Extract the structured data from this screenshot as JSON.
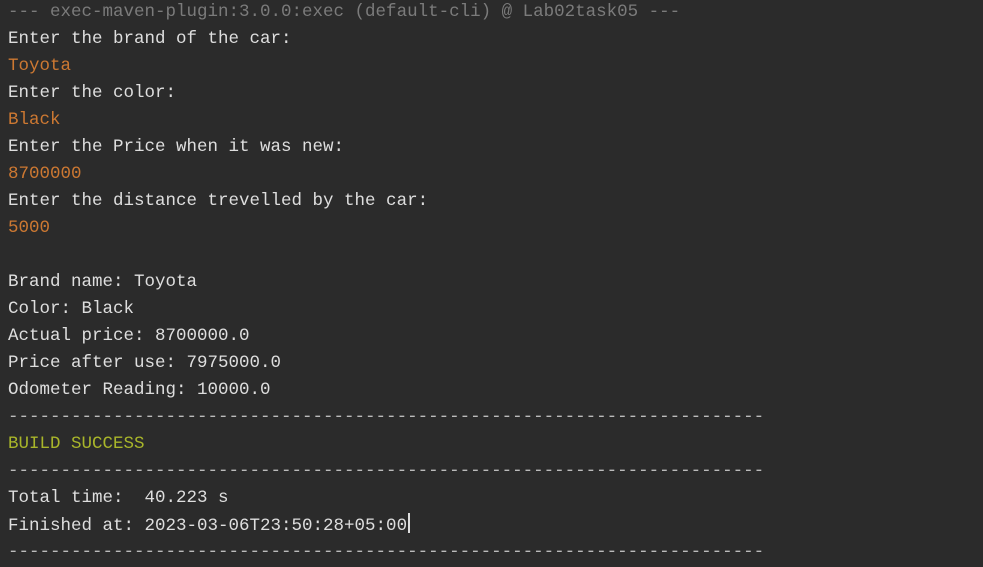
{
  "console": {
    "header": "--- exec-maven-plugin:3.0.0:exec (default-cli) @ Lab02task05 ---",
    "prompt_brand": "Enter the brand of the car:",
    "input_brand": "Toyota",
    "prompt_color": "Enter the color:",
    "input_color": "Black",
    "prompt_price": "Enter the Price when it was new:",
    "input_price": "8700000",
    "prompt_distance": "Enter the distance trevelled by the car:",
    "input_distance": "5000",
    "out_brand": "Brand name: Toyota",
    "out_color": "Color: Black",
    "out_actual_price": "Actual price: 8700000.0",
    "out_price_after_use": "Price after use: 7975000.0",
    "out_odometer": "Odometer Reading: 10000.0",
    "separator": "------------------------------------------------------------------------",
    "build_status": "BUILD SUCCESS",
    "total_time": "Total time:  40.223 s",
    "finished_at": "Finished at: 2023-03-06T23:50:28+05:00"
  },
  "colors": {
    "background": "#2b2b2b",
    "text": "#dedede",
    "header": "#7b7b7b",
    "user_input": "#cc7832",
    "build_success": "#a8b52a"
  }
}
